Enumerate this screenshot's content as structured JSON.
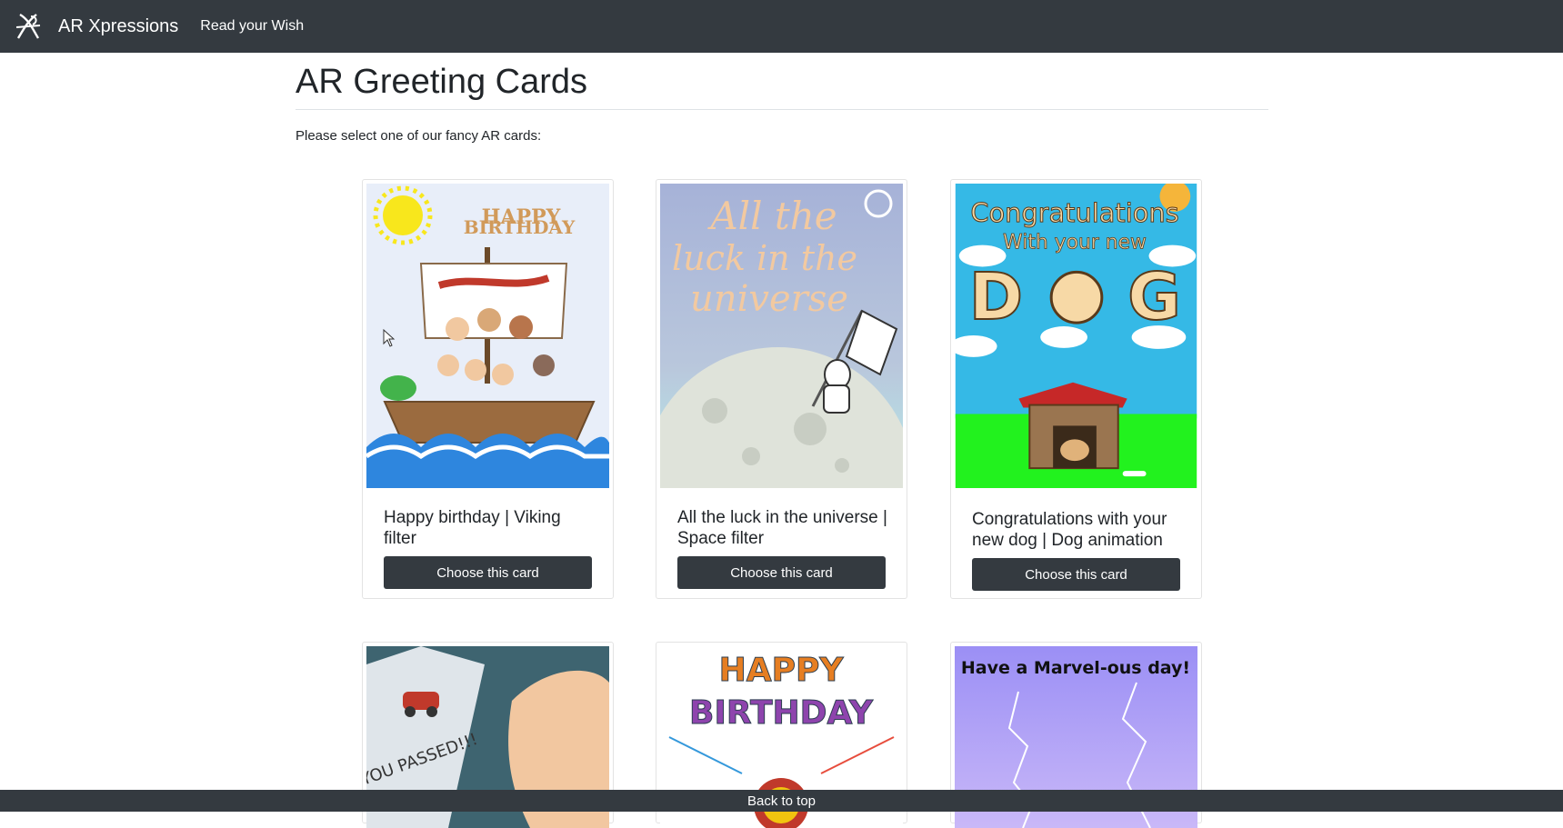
{
  "navbar": {
    "brand": "AR Xpressions",
    "link": "Read your Wish",
    "logo_icon": "ar-logo-icon"
  },
  "page": {
    "title": "AR Greeting Cards",
    "lead": "Please select one of our fancy AR cards:"
  },
  "cards": [
    {
      "title": "Happy birthday | Viking filter",
      "button": "Choose this card",
      "image_text": [
        "HAPPY",
        "BIRTHDAY"
      ]
    },
    {
      "title": "All the luck in the universe | Space filter",
      "button": "Choose this card",
      "image_text": [
        "All the",
        "luck in the",
        "universe"
      ]
    },
    {
      "title": "Congratulations with your new dog | Dog animation",
      "button": "Choose this card",
      "image_text": [
        "Congratulations",
        "With your new",
        "D",
        "G"
      ]
    },
    {
      "image_text": [
        "YOU PASSED!!!"
      ]
    },
    {
      "image_text": [
        "HAPPY",
        "BIRTHDAY"
      ]
    },
    {
      "image_text": [
        "Have a Marvel-ous day!"
      ]
    }
  ],
  "footer": {
    "back_to_top": "Back to top"
  },
  "colors": {
    "navbar": "#343a40",
    "button": "#343a40",
    "page_bg": "#ffffff"
  }
}
